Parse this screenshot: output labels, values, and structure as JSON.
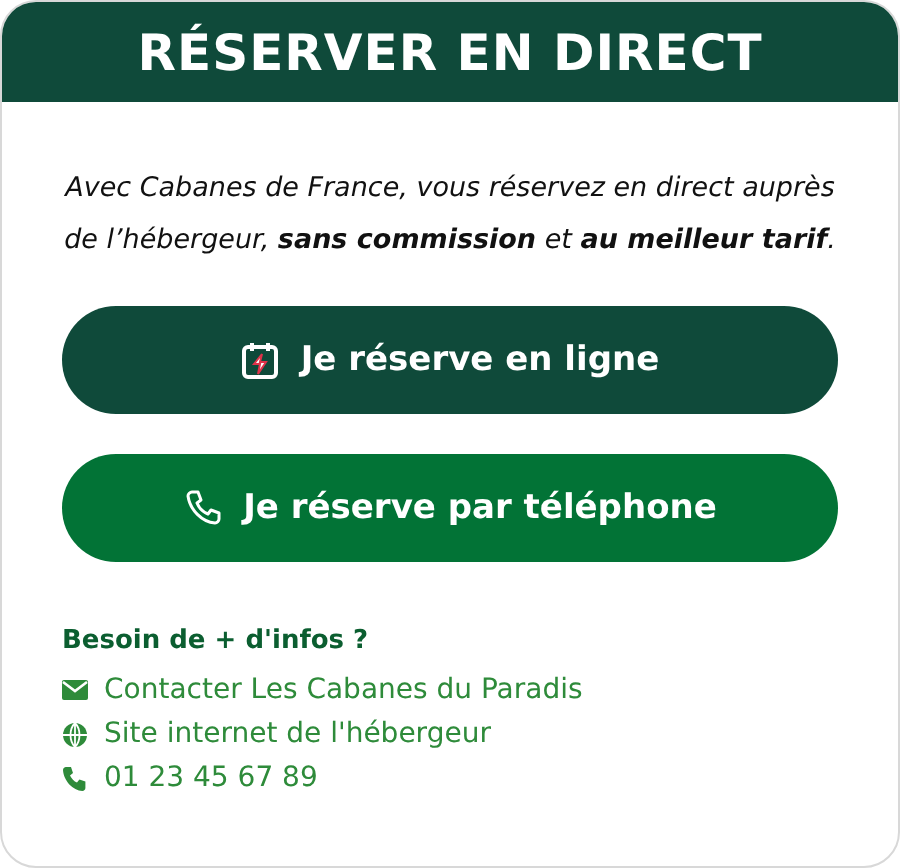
{
  "header": {
    "title": "RÉSERVER EN DIRECT"
  },
  "intro": "Avec Cabanes de France, vous réservez en direct auprès de l’hébergeur, **sans commission** et **au meilleur tarif**.",
  "buttons": [
    {
      "kind": "online",
      "label": "Je réserve en ligne"
    },
    {
      "kind": "phone",
      "label": "Je réserve par téléphone"
    }
  ],
  "info": {
    "title": "Besoin de + d'infos ?",
    "links": [
      {
        "kind": "mail",
        "label": "Contacter Les Cabanes du Paradis"
      },
      {
        "kind": "web",
        "label": "Site internet de l'hébergeur"
      },
      {
        "kind": "phone",
        "label": "01 23 45 67 89"
      }
    ]
  }
}
